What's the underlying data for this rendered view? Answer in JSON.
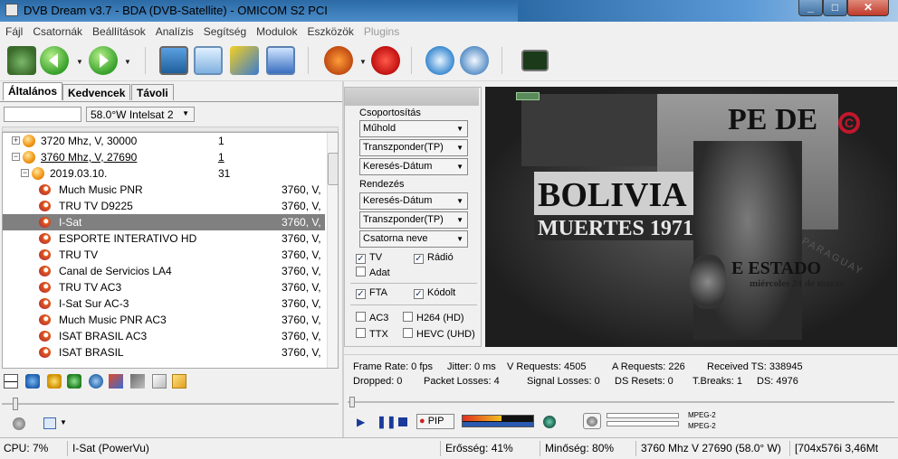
{
  "window": {
    "title": "DVB Dream v3.7 - BDA (DVB-Satellite)  -  OMICOM S2 PCI"
  },
  "menu": [
    "Fájl",
    "Csatornák",
    "Beállítások",
    "Analízis",
    "Segítség",
    "Modulok",
    "Eszközök",
    "Plugins"
  ],
  "tabs": [
    "Általános",
    "Kedvencek",
    "Távoli"
  ],
  "satellite": {
    "input_value": "",
    "selected": "58.0°W Intelsat 2"
  },
  "tree": [
    {
      "type": "tp",
      "expander": "+",
      "label": "3720 Mhz, V, 30000",
      "count": "1"
    },
    {
      "type": "tp",
      "expander": "−",
      "label": "3760 Mhz, V, 27690",
      "count": "1"
    },
    {
      "type": "date",
      "expander": "−",
      "label": "2019.03.10.",
      "count": "31"
    },
    {
      "type": "ch",
      "label": "Much Music PNR",
      "info": "3760, V,"
    },
    {
      "type": "ch",
      "label": "TRU TV D9225",
      "info": "3760, V,"
    },
    {
      "type": "ch",
      "label": "I-Sat",
      "info": "3760, V,",
      "selected": true
    },
    {
      "type": "ch",
      "label": "ESPORTE INTERATIVO HD",
      "info": "3760, V,"
    },
    {
      "type": "ch",
      "label": "TRU TV",
      "info": "3760, V,"
    },
    {
      "type": "ch",
      "label": "Canal de Servicios LA4",
      "info": "3760, V,"
    },
    {
      "type": "ch",
      "label": "TRU TV AC3",
      "info": "3760, V,"
    },
    {
      "type": "ch",
      "label": "I-Sat Sur AC-3",
      "info": "3760, V,"
    },
    {
      "type": "ch",
      "label": "Much Music PNR AC3",
      "info": "3760, V,"
    },
    {
      "type": "ch",
      "label": "ISAT BRASIL AC3",
      "info": "3760, V,"
    },
    {
      "type": "ch",
      "label": "ISAT BRASIL",
      "info": "3760, V,"
    }
  ],
  "filters": {
    "grouping_label": "Csoportosítás",
    "grouping": [
      "Műhold",
      "Transzponder(TP)",
      "Keresés-Dátum"
    ],
    "sorting_label": "Rendezés",
    "sorting": [
      "Keresés-Dátum",
      "Transzponder(TP)",
      "Csatorna neve"
    ],
    "tv_label": "TV",
    "radio_label": "Rádió",
    "data_label": "Adat",
    "fta_label": "FTA",
    "coded_label": "Kódolt",
    "ac3_label": "AC3",
    "h264_label": "H264 (HD)",
    "ttx_label": "TTX",
    "hevc_label": "HEVC (UHD)"
  },
  "video": {
    "headline": "BOLIVIA",
    "subline": "MUERTES 1971",
    "paper_top": "PE DE",
    "estado": "E ESTADO",
    "date_line": "miércoles 24 de marzo",
    "paraguay": "PARAGUAY",
    "logo": "C"
  },
  "stats": {
    "frame_rate": "Frame Rate: 0 fps",
    "jitter": "Jitter: 0 ms",
    "v_requests": "V Requests: 4505",
    "a_requests": "A Requests: 226",
    "received_ts": "Received TS: 338945",
    "dropped": "Dropped: 0",
    "packet_losses": "Packet Losses: 4",
    "signal_losses": "Signal Losses: 0",
    "ds_resets": "DS Resets: 0",
    "t_breaks": "T.Breaks: 1",
    "ds": "DS: 4976"
  },
  "player": {
    "pip_label": "PIP",
    "codec_video": "MPEG-2",
    "codec_audio": "MPEG-2",
    "volume_fraction": 0.55
  },
  "status": {
    "cpu": "CPU: 7%",
    "channel": "I-Sat (PowerVu)",
    "strength": "Erősség: 41%",
    "quality": "Minőség: 80%",
    "transponder": "3760 Mhz  V  27690  (58.0° W)",
    "resolution": "[704x576i 3,46Mt"
  },
  "colors": {
    "accent": "#2b6aa5",
    "selected_row": "#808080",
    "video_bg": "#2a2a2a"
  }
}
